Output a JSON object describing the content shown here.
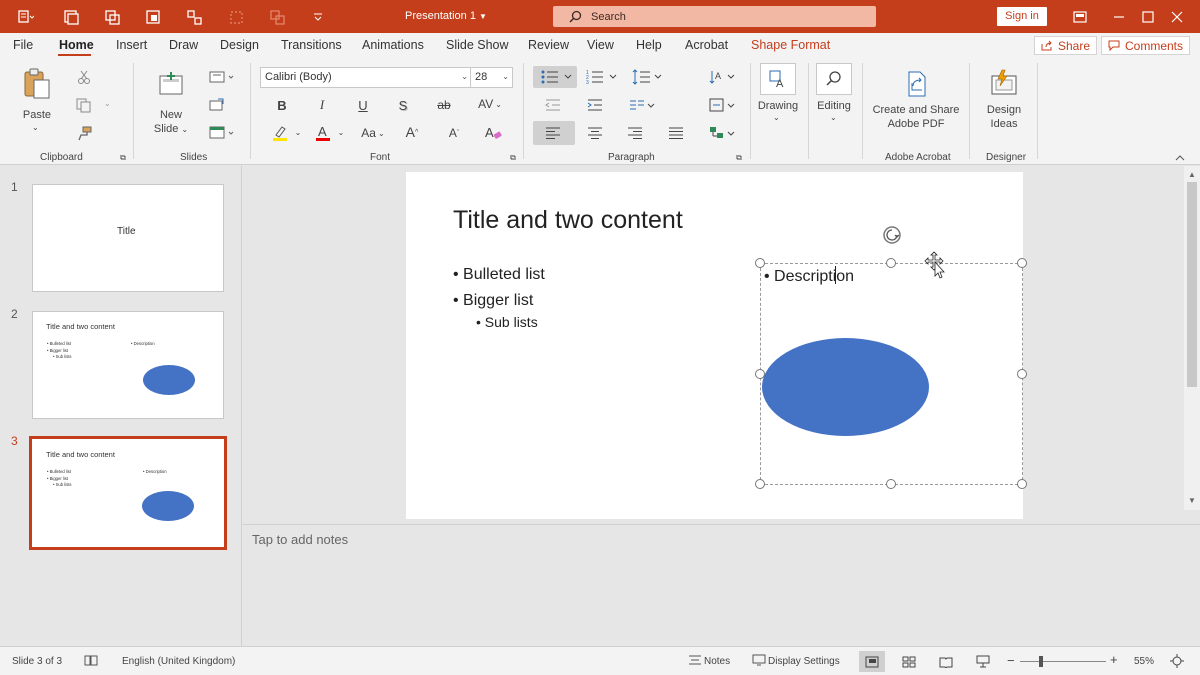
{
  "window": {
    "title": "Presentation 1",
    "search_placeholder": "Search",
    "sign_in": "Sign in",
    "accent": "#c43e1c"
  },
  "tabs": [
    "File",
    "Home",
    "Insert",
    "Draw",
    "Design",
    "Transitions",
    "Animations",
    "Slide Show",
    "Review",
    "View",
    "Help",
    "Acrobat",
    "Shape Format"
  ],
  "active_tab": "Home",
  "share": "Share",
  "comments": "Comments",
  "ribbon": {
    "clipboard": {
      "label": "Clipboard",
      "paste": "Paste"
    },
    "slides": {
      "label": "Slides",
      "new_slide_1": "New",
      "new_slide_2": "Slide"
    },
    "font": {
      "label": "Font",
      "name": "Calibri (Body)",
      "size": "28",
      "bold": "B",
      "italic": "I",
      "underline": "U",
      "shadow": "S",
      "strike": "ab",
      "spacing": "AV",
      "change_case": "Aa",
      "grow": "A",
      "shrink": "A"
    },
    "paragraph": {
      "label": "Paragraph"
    },
    "drawing": "Drawing",
    "editing": "Editing",
    "acrobat": {
      "label": "Adobe Acrobat",
      "btn_1": "Create and Share",
      "btn_2": "Adobe PDF"
    },
    "designer": {
      "label": "Designer",
      "btn_1": "Design",
      "btn_2": "Ideas"
    }
  },
  "thumbnails": [
    {
      "num": "1",
      "title": "Title"
    },
    {
      "num": "2",
      "title": "Title and two content",
      "bullets": [
        "• Bulleted list",
        "• Bigger list",
        "• Sub lists"
      ],
      "desc": "• Description"
    },
    {
      "num": "3",
      "title": "Title and two content",
      "bullets": [
        "• Bulleted list",
        "• Bigger list",
        "• Sub lists"
      ],
      "desc": "• Description"
    }
  ],
  "slide": {
    "title": "Title and two content",
    "bullets": [
      "• Bulleted list",
      "• Bigger list"
    ],
    "sub_bullet": "• Sub lists",
    "desc_before_caret": "• Descripti",
    "desc_after_caret": "on",
    "shape_color": "#4472c4"
  },
  "notes_placeholder": "Tap to add notes",
  "status": {
    "slide_of": "Slide 3 of 3",
    "language": "English (United Kingdom)",
    "notes": "Notes",
    "display_settings": "Display Settings",
    "zoom": "55%"
  }
}
